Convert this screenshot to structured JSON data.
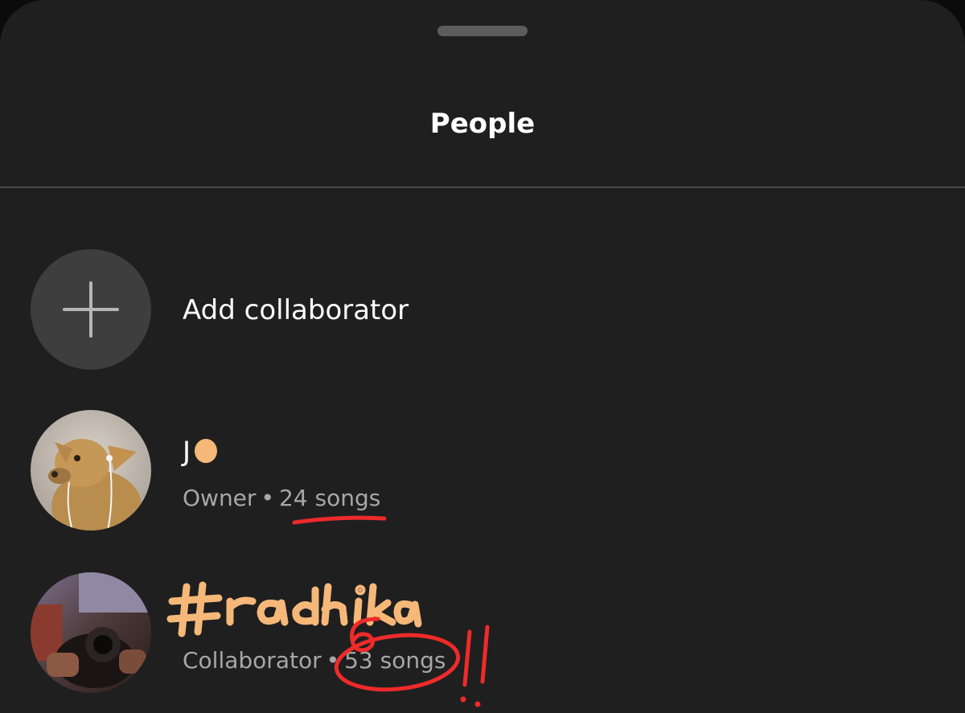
{
  "sheet": {
    "title": "People"
  },
  "add_row": {
    "label": "Add collaborator",
    "icon": "plus-icon"
  },
  "people": [
    {
      "name": "J",
      "role": "Owner",
      "separator": "•",
      "songs": "24 songs",
      "avatar": "dog-photo"
    },
    {
      "name": "",
      "role": "Collaborator",
      "separator": "•",
      "songs": "53 songs",
      "avatar": "camera-photo"
    }
  ],
  "annotations": {
    "color_red": "#ef2a2a",
    "color_orange": "#f6b878",
    "handwritten_name": "#radhika",
    "handwritten_digit": "6",
    "handwritten_marks": "!!"
  }
}
